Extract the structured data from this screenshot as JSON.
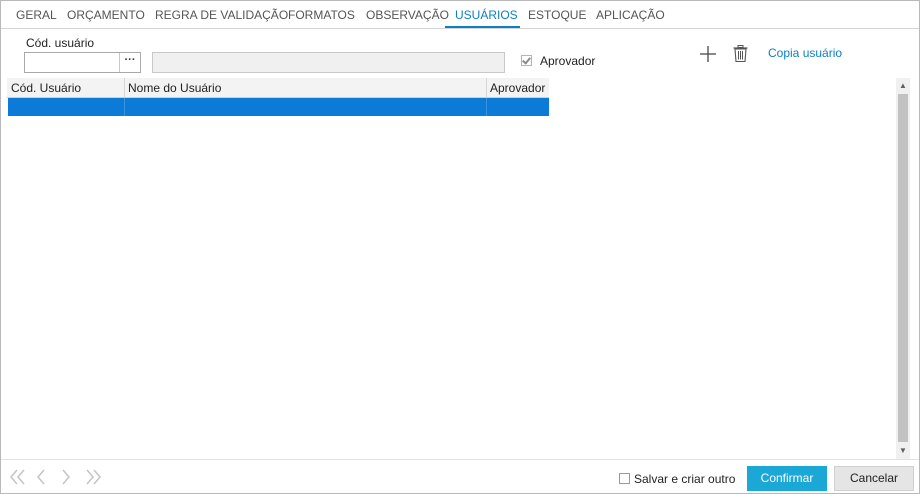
{
  "tabs": [
    {
      "label": "GERAL"
    },
    {
      "label": "ORÇAMENTO"
    },
    {
      "label": "REGRA DE VALIDAÇÃO"
    },
    {
      "label": "FORMATOS"
    },
    {
      "label": "OBSERVAÇÃO"
    },
    {
      "label": "USUÁRIOS",
      "active": true
    },
    {
      "label": "ESTOQUE"
    },
    {
      "label": "APLICAÇÃO"
    }
  ],
  "form": {
    "cod_usuario_label": "Cód. usuário",
    "cod_usuario_value": "",
    "ellipsis_label": "···",
    "nome_value": "",
    "aprovador_label": "Aprovador",
    "aprovador_checked": true
  },
  "toolbar": {
    "add_icon": "plus-icon",
    "delete_icon": "trash-icon",
    "copy_link": "Copia usuário"
  },
  "grid": {
    "columns": [
      "Cód. Usuário",
      "Nome do Usuário",
      "Aprovador"
    ],
    "rows": [
      {
        "cod": "",
        "nome": "",
        "aprovador": "",
        "selected": true
      }
    ]
  },
  "footer": {
    "nav_icons": [
      "first-icon",
      "prev-icon",
      "next-icon",
      "last-icon"
    ],
    "save_and_new_label": "Salvar e criar outro",
    "confirm_label": "Confirmar",
    "cancel_label": "Cancelar"
  },
  "colors": {
    "accent": "#0d7fc4",
    "selected_row": "#0c7bd7",
    "confirm_button": "#1ba8d6"
  }
}
